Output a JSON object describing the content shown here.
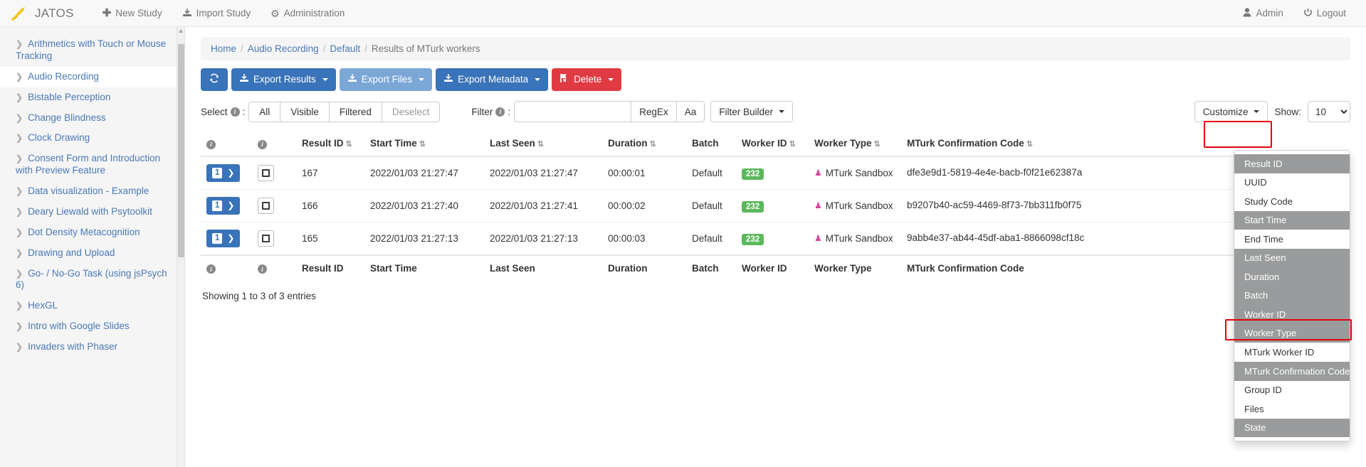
{
  "navbar": {
    "brand": "JATOS",
    "links": [
      {
        "label": "New Study",
        "icon": "plus-icon"
      },
      {
        "label": "Import Study",
        "icon": "import-icon"
      },
      {
        "label": "Administration",
        "icon": "gear-icon"
      }
    ],
    "right_links": [
      {
        "label": "Admin",
        "icon": "user-icon"
      },
      {
        "label": "Logout",
        "icon": "power-icon"
      }
    ]
  },
  "sidebar": {
    "items": [
      {
        "label": "Arithmetics with Touch or Mouse Tracking",
        "active": false
      },
      {
        "label": "Audio Recording",
        "active": true
      },
      {
        "label": "Bistable Perception",
        "active": false
      },
      {
        "label": "Change Blindness",
        "active": false
      },
      {
        "label": "Clock Drawing",
        "active": false
      },
      {
        "label": "Consent Form and Introduction with Preview Feature",
        "active": false
      },
      {
        "label": "Data visualization - Example",
        "active": false
      },
      {
        "label": "Deary Liewald with Psytoolkit",
        "active": false
      },
      {
        "label": "Dot Density Metacognition",
        "active": false
      },
      {
        "label": "Drawing and Upload",
        "active": false
      },
      {
        "label": "Go- / No-Go Task (using jsPsych 6)",
        "active": false
      },
      {
        "label": "HexGL",
        "active": false
      },
      {
        "label": "Intro with Google Slides",
        "active": false
      },
      {
        "label": "Invaders with Phaser",
        "active": false
      }
    ]
  },
  "breadcrumb": {
    "items": [
      "Home",
      "Audio Recording",
      "Default"
    ],
    "current": "Results of MTurk workers"
  },
  "toolbar": {
    "refresh_label": "",
    "buttons": [
      {
        "label": "Export Results",
        "style": "blue",
        "icon": "export-icon"
      },
      {
        "label": "Export Files",
        "style": "blue-light",
        "icon": "export-icon"
      },
      {
        "label": "Export Metadata",
        "style": "blue",
        "icon": "export-icon"
      },
      {
        "label": "Delete",
        "style": "red",
        "icon": "delete-icon"
      }
    ]
  },
  "controls": {
    "select_label": "Select",
    "select_buttons": [
      "All",
      "Visible",
      "Filtered",
      "Deselect"
    ],
    "filter_label": "Filter",
    "filter_value": "",
    "filter_placeholder": "",
    "regex_label": "RegEx",
    "case_label": "Aa",
    "filter_builder_label": "Filter Builder",
    "customize_label": "Customize",
    "show_label": "Show:",
    "show_value": "10"
  },
  "table": {
    "headers": [
      {
        "label": "",
        "sortable": false,
        "icon": "info-icon"
      },
      {
        "label": "",
        "sortable": false,
        "icon": "info-icon"
      },
      {
        "label": "Result ID",
        "sortable": true
      },
      {
        "label": "Start Time",
        "sortable": true
      },
      {
        "label": "Last Seen",
        "sortable": true
      },
      {
        "label": "Duration",
        "sortable": true
      },
      {
        "label": "Batch",
        "sortable": false
      },
      {
        "label": "Worker ID",
        "sortable": true
      },
      {
        "label": "Worker Type",
        "sortable": true
      },
      {
        "label": "MTurk Confirmation Code",
        "sortable": true
      }
    ],
    "footers": [
      "",
      "",
      "Result ID",
      "Start Time",
      "Last Seen",
      "Duration",
      "Batch",
      "Worker ID",
      "Worker Type",
      "MTurk Confirmation Code"
    ],
    "rows": [
      {
        "count": "1",
        "result_id": "167",
        "start_time": "2022/01/03 21:27:47",
        "last_seen": "2022/01/03 21:27:47",
        "duration": "00:00:01",
        "batch": "Default",
        "worker_id": "232",
        "worker_type": "MTurk Sandbox",
        "confirmation_code": "dfe3e9d1-5819-4e4e-bacb-f0f21e62387a"
      },
      {
        "count": "1",
        "result_id": "166",
        "start_time": "2022/01/03 21:27:40",
        "last_seen": "2022/01/03 21:27:41",
        "duration": "00:00:02",
        "batch": "Default",
        "worker_id": "232",
        "worker_type": "MTurk Sandbox",
        "confirmation_code": "b9207b40-ac59-4469-8f73-7bb311fb0f75"
      },
      {
        "count": "1",
        "result_id": "165",
        "start_time": "2022/01/03 21:27:13",
        "last_seen": "2022/01/03 21:27:13",
        "duration": "00:00:03",
        "batch": "Default",
        "worker_id": "232",
        "worker_type": "MTurk Sandbox",
        "confirmation_code": "9abb4e37-ab44-45df-aba1-8866098cf18c"
      }
    ],
    "showing": "Showing 1 to 3 of 3 entries"
  },
  "dropdown": {
    "items": [
      {
        "label": "Result ID",
        "selected": true
      },
      {
        "label": "UUID",
        "selected": false
      },
      {
        "label": "Study Code",
        "selected": false
      },
      {
        "label": "Start Time",
        "selected": true
      },
      {
        "label": "End Time",
        "selected": false
      },
      {
        "label": "Last Seen",
        "selected": true
      },
      {
        "label": "Duration",
        "selected": true
      },
      {
        "label": "Batch",
        "selected": true
      },
      {
        "label": "Worker ID",
        "selected": true
      },
      {
        "label": "Worker Type",
        "selected": true
      },
      {
        "label": "MTurk Worker ID",
        "selected": false
      },
      {
        "label": "MTurk Confirmation Code",
        "selected": true
      },
      {
        "label": "Group ID",
        "selected": false
      },
      {
        "label": "Files",
        "selected": false
      },
      {
        "label": "State",
        "selected": true
      }
    ]
  },
  "colors": {
    "accent_blue": "#3973b9",
    "light_blue": "#7ba7d7",
    "danger_red": "#e03b43",
    "badge_green": "#5cb85c",
    "highlight_red": "#e8000d",
    "link_blue": "#4a79b5"
  }
}
